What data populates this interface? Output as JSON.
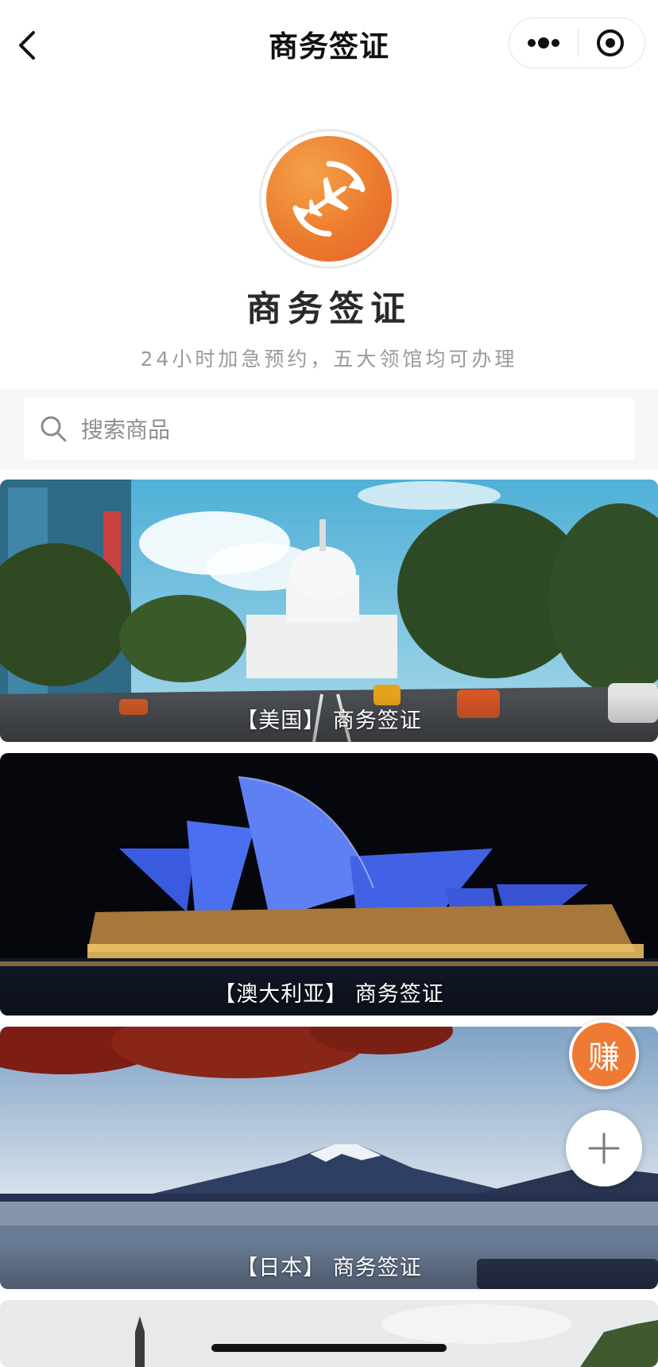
{
  "nav": {
    "title": "商务签证",
    "back_icon": "chevron-left-icon",
    "more_icon": "more-dots-icon",
    "close_icon": "target-close-icon"
  },
  "shop": {
    "name": "商务签证",
    "slogan": "24小时加急预约，五大领馆均可办理",
    "logo_icon": "plane-refresh-icon",
    "brand_color": "#ec7b2e"
  },
  "search": {
    "placeholder": "搜索商品",
    "value": ""
  },
  "products": [
    {
      "label": "【美国】 商务签证",
      "image": "us-capitol-street-photo"
    },
    {
      "label": "【澳大利亚】 商务签证",
      "image": "sydney-opera-house-night-photo"
    },
    {
      "label": "【日本】 商务签证",
      "image": "mount-fuji-lake-photo"
    }
  ],
  "fabs": {
    "earn_label": "赚",
    "earn_color": "#ee7a33",
    "plus_icon": "plus-icon"
  }
}
